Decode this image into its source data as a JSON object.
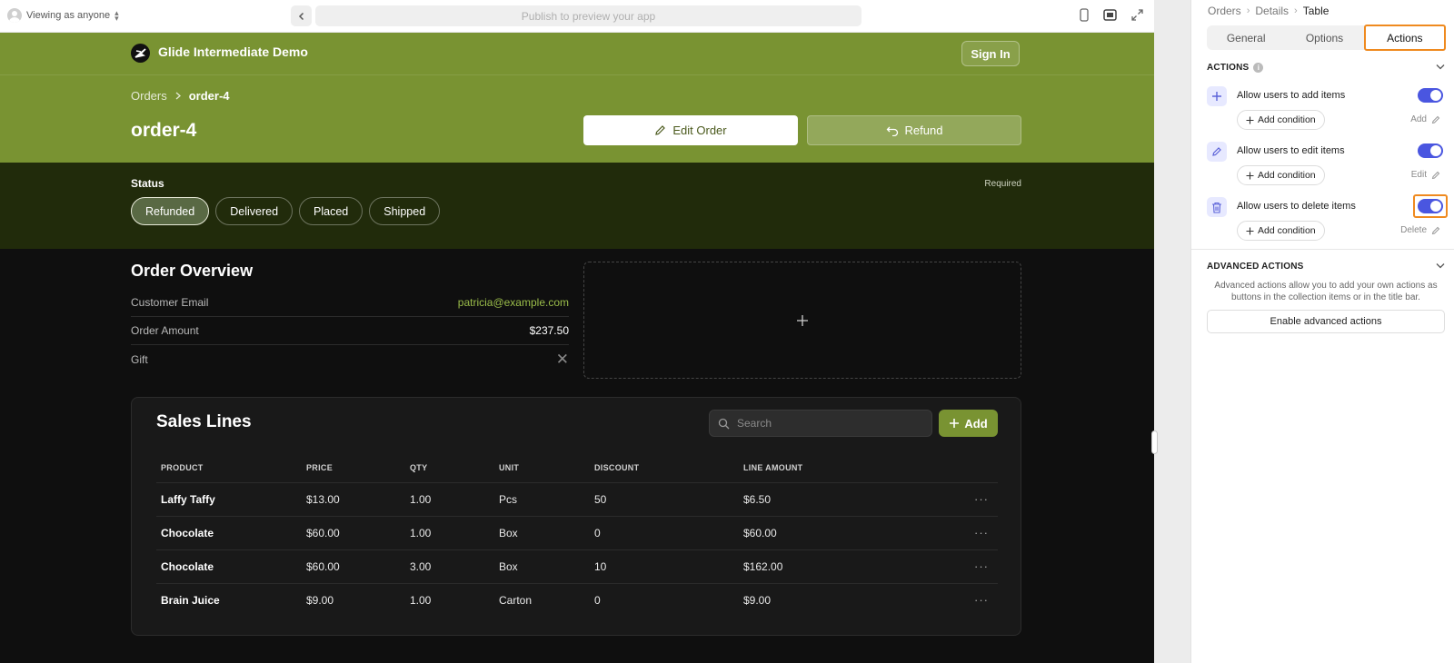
{
  "topbar": {
    "viewing": "Viewing as anyone",
    "url_placeholder": "Publish to preview your app"
  },
  "app": {
    "name": "Glide Intermediate Demo",
    "sign_in": "Sign In",
    "accent": "#799332"
  },
  "breadcrumb": {
    "parent": "Orders",
    "current": "order-4"
  },
  "page": {
    "title": "order-4",
    "edit_label": "Edit Order",
    "refund_label": "Refund"
  },
  "status": {
    "label": "Status",
    "required": "Required",
    "options": [
      "Refunded",
      "Delivered",
      "Placed",
      "Shipped"
    ],
    "selected": "Refunded"
  },
  "overview": {
    "title": "Order Overview",
    "fields": [
      {
        "label": "Customer Email",
        "value": "patricia@example.com"
      },
      {
        "label": "Order Amount",
        "value": "$237.50"
      },
      {
        "label": "Gift",
        "value": "✕"
      }
    ],
    "image_placeholder_icon": "plus-icon"
  },
  "sales": {
    "title": "Sales Lines",
    "search_placeholder": "Search",
    "add_label": "Add",
    "columns": [
      "PRODUCT",
      "PRICE",
      "QTY",
      "UNIT",
      "DISCOUNT",
      "LINE AMOUNT"
    ],
    "rows": [
      [
        "Laffy Taffy",
        "$13.00",
        "1.00",
        "Pcs",
        "50",
        "$6.50"
      ],
      [
        "Chocolate",
        "$60.00",
        "1.00",
        "Box",
        "0",
        "$60.00"
      ],
      [
        "Chocolate",
        "$60.00",
        "3.00",
        "Box",
        "10",
        "$162.00"
      ],
      [
        "Brain Juice",
        "$9.00",
        "1.00",
        "Carton",
        "0",
        "$9.00"
      ]
    ],
    "row_menu": "···"
  },
  "panel": {
    "breadcrumb": [
      "Orders",
      "Details",
      "Table"
    ],
    "tabs": [
      "General",
      "Options",
      "Actions"
    ],
    "active_tab": "Actions",
    "actions_header": "ACTIONS",
    "actions": [
      {
        "label": "Allow users to add items",
        "icon": "plus-icon",
        "enabled": true,
        "condition": "Add condition",
        "edit": "Add"
      },
      {
        "label": "Allow users to edit items",
        "icon": "pencil-icon",
        "enabled": true,
        "condition": "Add condition",
        "edit": "Edit"
      },
      {
        "label": "Allow users to delete items",
        "icon": "trash-icon",
        "enabled": true,
        "condition": "Add condition",
        "edit": "Delete"
      }
    ],
    "advanced_header": "ADVANCED ACTIONS",
    "advanced_desc": "Advanced actions allow you to add your own actions as buttons in the collection items or in the title bar.",
    "advanced_button": "Enable advanced actions",
    "toggle_color": "#4a56e0",
    "highlight_color": "#ef8a1f"
  }
}
